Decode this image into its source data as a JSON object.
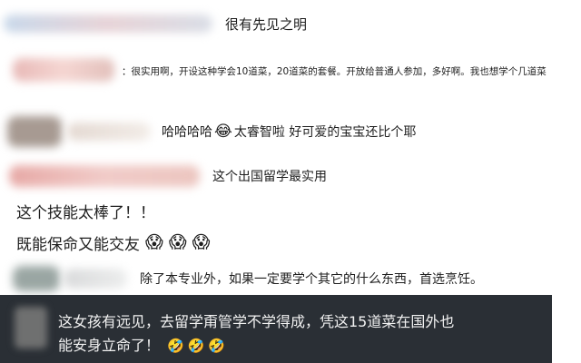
{
  "comments": [
    {
      "text": "很有先见之明"
    },
    {
      "text": "：很实用啊，开设这种学会10道菜，20道菜的套餐。开放给普通人参加，多好啊。我也想学个几道菜"
    },
    {
      "text_a": "哈哈哈哈",
      "text_b": "太睿智啦 好可爱的宝宝还比个耶",
      "emoji": "😂"
    },
    {
      "text": "这个出国留学最实用"
    },
    {
      "text": "这个技能太棒了！！"
    },
    {
      "text": "既能保命又能交友",
      "emoji": "😱"
    },
    {
      "text": "除了本专业外，如果一定要学个其它的什么东西，首选烹饪。"
    },
    {
      "line1": "这女孩有远见，去留学甭管学不学得成，凭这15道菜在国外也",
      "line2": "能安身立命了！",
      "emoji": "🤣"
    }
  ],
  "colors": {
    "dark_box": "#2a2f35",
    "dark_text": "#f2f2f2",
    "name_pink": "#f2c9c7",
    "name_blue": "#c9d9ec"
  }
}
